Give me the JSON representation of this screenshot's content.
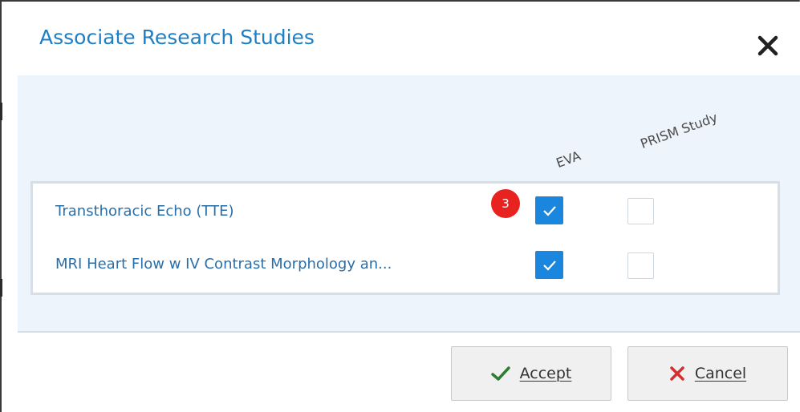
{
  "dialog": {
    "title": "Associate Research Studies"
  },
  "columns": {
    "eva": "EVA",
    "prism": "PRISM Study"
  },
  "rows": [
    {
      "label": "Transthoracic Echo (TTE)",
      "eva_checked": true,
      "prism_checked": false
    },
    {
      "label": "MRI Heart Flow w IV Contrast Morphology an...",
      "eva_checked": true,
      "prism_checked": false
    }
  ],
  "badge": {
    "count": "3",
    "color": "#e8231f"
  },
  "footer": {
    "accept_label": "Accept",
    "cancel_label": "Cancel"
  },
  "colors": {
    "title": "#1e7fc4",
    "checkbox_checked": "#1b86dd",
    "body_bg": "#eef4fb",
    "accept_icon": "#2e7d32",
    "cancel_icon": "#d32f2f"
  },
  "icons": {
    "close": "close-icon",
    "accept": "checkmark-icon",
    "cancel": "x-icon"
  }
}
